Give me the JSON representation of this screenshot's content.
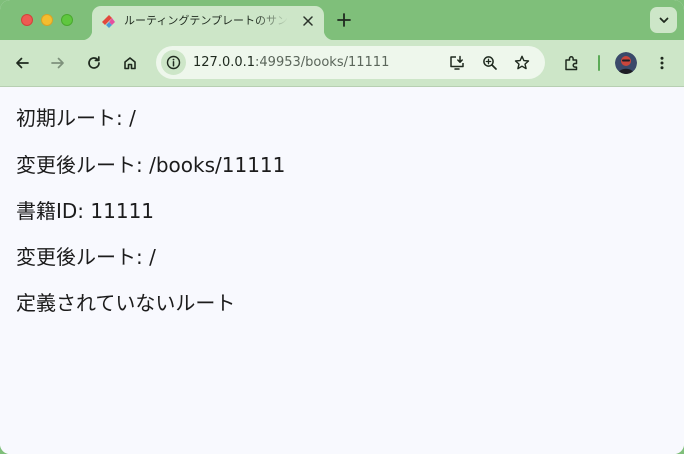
{
  "browser": {
    "tab": {
      "title": "ルーティングテンプレートのサンプル"
    },
    "omnibox": {
      "url_host": "127.0.0.1",
      "url_rest": ":49953/books/11111"
    }
  },
  "page": {
    "lines": [
      "初期ルート: /",
      "変更後ルート: /books/11111",
      "書籍ID: 11111",
      "変更後ルート: /",
      "定義されていないルート"
    ]
  },
  "colors": {
    "frame": "#7fbf7a",
    "toolbar": "#cde6c8",
    "page_background": "#f8f9fe",
    "text": "#1c1c1c"
  },
  "icons": [
    "flutter-favicon-icon",
    "close-icon",
    "plus-icon",
    "chevron-down-icon",
    "back-arrow-icon",
    "forward-arrow-icon",
    "reload-icon",
    "home-icon",
    "info-icon",
    "install-app-icon",
    "zoom-icon",
    "star-icon",
    "extensions-icon",
    "more-vert-icon"
  ]
}
